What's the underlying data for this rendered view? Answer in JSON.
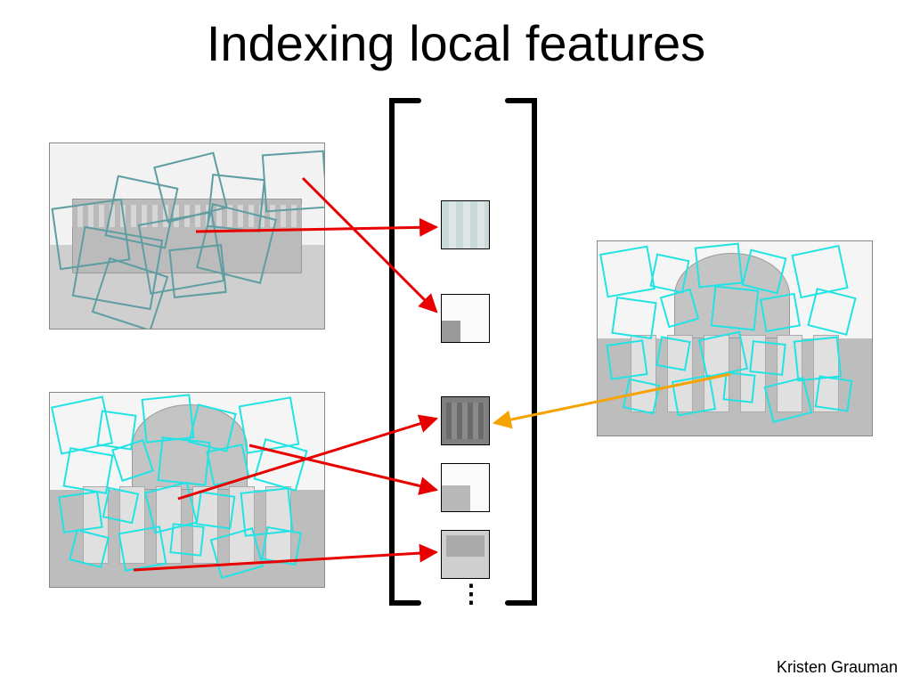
{
  "title": "Indexing local features",
  "attribution": "Kristen Grauman",
  "vdots_glyph": "⋮",
  "left_images": [
    {
      "name": "city-hall-photo",
      "feature_overlay_color": "teal",
      "feature_box_count_approx": 18,
      "arrows_to_patches": [
        0,
        1
      ]
    },
    {
      "name": "capitol-photo-left",
      "feature_overlay_color": "cyan",
      "feature_box_count_approx": 70,
      "arrows_to_patches": [
        2,
        3,
        4
      ]
    }
  ],
  "right_image": {
    "name": "capitol-photo-right",
    "feature_overlay_color": "cyan",
    "feature_box_count_approx": 70,
    "arrows_to_patches": [
      2
    ],
    "arrow_color": "orange"
  },
  "feature_vector": {
    "bracket_style": "large-square-brackets",
    "patches": [
      {
        "idx": 0,
        "style": "columns-teal"
      },
      {
        "idx": 1,
        "style": "mostly-blank"
      },
      {
        "idx": 2,
        "style": "dark-columns"
      },
      {
        "idx": 3,
        "style": "building-gray"
      },
      {
        "idx": 4,
        "style": "building-gray"
      }
    ],
    "continuation": "vdots"
  },
  "arrows": [
    {
      "from": "city-hall-photo",
      "to_patch": 0,
      "color": "red"
    },
    {
      "from": "city-hall-photo",
      "to_patch": 1,
      "color": "red"
    },
    {
      "from": "capitol-photo-left",
      "to_patch": 2,
      "color": "red"
    },
    {
      "from": "capitol-photo-left",
      "to_patch": 3,
      "color": "red"
    },
    {
      "from": "capitol-photo-left",
      "to_patch": 4,
      "color": "red"
    },
    {
      "from": "capitol-photo-right",
      "to_patch": 2,
      "color": "orange"
    }
  ]
}
